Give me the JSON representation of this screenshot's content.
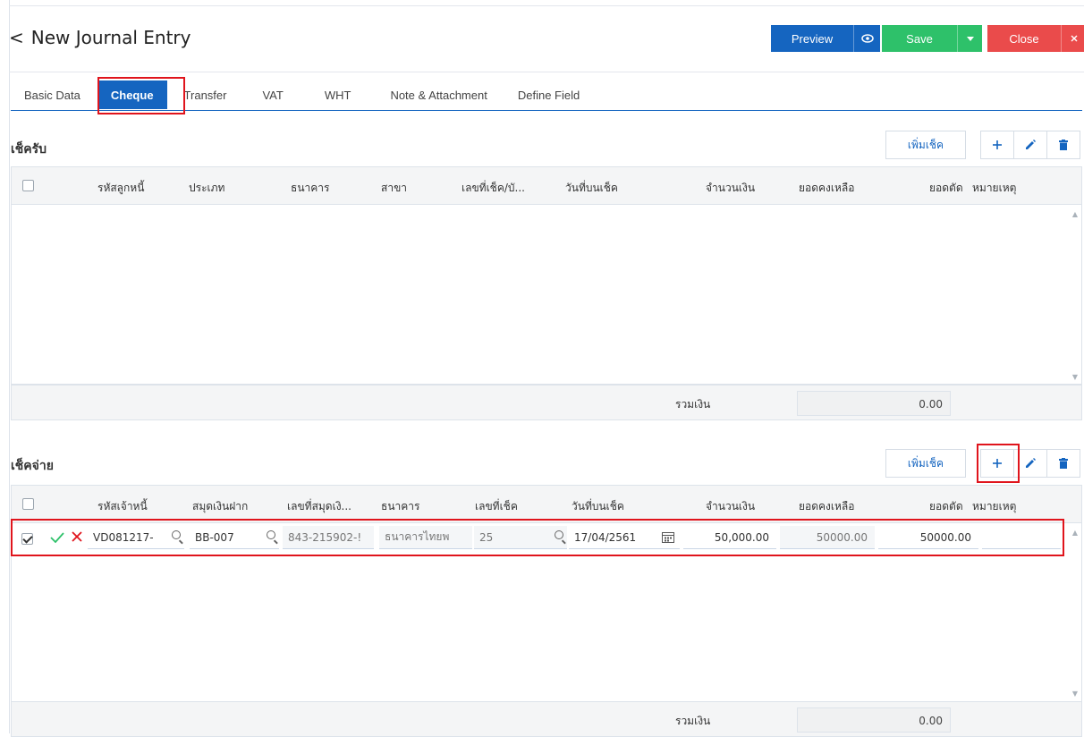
{
  "header": {
    "back_glyph": "<",
    "title": "New Journal Entry",
    "preview_label": "Preview",
    "save_label": "Save",
    "close_label": "Close"
  },
  "tabs": [
    {
      "label": "Basic Data"
    },
    {
      "label": "Cheque",
      "active": true
    },
    {
      "label": "Transfer"
    },
    {
      "label": "VAT"
    },
    {
      "label": "WHT"
    },
    {
      "label": "Note & Attachment"
    },
    {
      "label": "Define Field"
    }
  ],
  "received": {
    "title": "เช็ครับ",
    "add_cheque_label": "เพิ่มเช็ค",
    "columns": [
      "รหัสลูกหนี้",
      "ประเภท",
      "ธนาคาร",
      "สาขา",
      "เลขที่เช็ค/บั...",
      "วันที่บนเช็ค",
      "จำนวนเงิน",
      "ยอดคงเหลือ",
      "ยอดตัด",
      "หมายเหตุ"
    ],
    "total_label": "รวมเงิน",
    "total_value": "0.00"
  },
  "paid": {
    "title": "เช็คจ่าย",
    "add_cheque_label": "เพิ่มเช็ค",
    "columns": [
      "รหัสเจ้าหนี้",
      "สมุดเงินฝาก",
      "เลขที่สมุดเงิ...",
      "ธนาคาร",
      "เลขที่เช็ค",
      "วันที่บนเช็ค",
      "จำนวนเงิน",
      "ยอดคงเหลือ",
      "ยอดตัด",
      "หมายเหตุ"
    ],
    "row": {
      "creditor_code": "VD081217-",
      "passbook": "BB-007",
      "passbook_no": "843-215902-!",
      "bank": "ธนาคารไทยพ",
      "cheque_no": "25",
      "cheque_date": "17/04/2561",
      "amount": "50,000.00",
      "balance": "50000.00",
      "cut_amount": "50000.00",
      "note": ""
    },
    "total_label": "รวมเงิน",
    "total_value": "0.00"
  },
  "colors": {
    "primary": "#1565c0",
    "save": "#2ec16a",
    "close": "#ea4b4b",
    "highlight": "#e0141c"
  }
}
